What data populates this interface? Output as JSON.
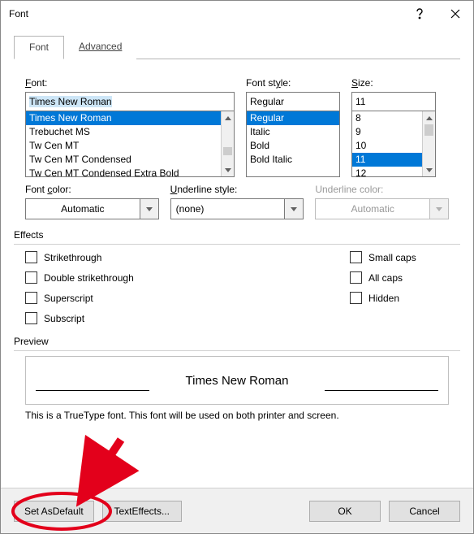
{
  "title": "Font",
  "tabs": {
    "font": "Font",
    "advanced": "Advanced"
  },
  "labels": {
    "font": "Font:",
    "font_key": "F",
    "style": "Font style:",
    "style_key": "y",
    "size": "Size:",
    "size_key": "S",
    "color": "Font color:",
    "color_key": "c",
    "uline": "Underline style:",
    "uline_key": "U",
    "ulcolor": "Underline color:",
    "ulcolor_key": "U"
  },
  "font_input": "Times New Roman",
  "font_list": [
    "Times New Roman",
    "Trebuchet MS",
    "Tw Cen MT",
    "Tw Cen MT Condensed",
    "Tw Cen MT Condensed Extra Bold"
  ],
  "font_selected_index": 0,
  "style_input": "Regular",
  "style_list": [
    "Regular",
    "Italic",
    "Bold",
    "Bold Italic"
  ],
  "style_selected_index": 0,
  "size_input": "11",
  "size_list": [
    "8",
    "9",
    "10",
    "11",
    "12"
  ],
  "size_selected_index": 3,
  "font_color": "Automatic",
  "underline_style": "(none)",
  "underline_color": "Automatic",
  "effects_title": "Effects",
  "effects": {
    "strike": "Strikethrough",
    "dstrike": "Double strikethrough",
    "super": "Superscript",
    "sub": "Subscript",
    "smallcaps": "Small caps",
    "allcaps": "All caps",
    "hidden": "Hidden"
  },
  "effects_keys": {
    "strike": "k",
    "dstrike": "l",
    "super": "p",
    "sub": "b",
    "smallcaps": "m",
    "allcaps": "A",
    "hidden": "H"
  },
  "preview_title": "Preview",
  "preview_text": "Times New Roman",
  "desc": "This is a TrueType font. This font will be used on both printer and screen.",
  "buttons": {
    "default": "Set As Default",
    "default_key": "D",
    "texteffects": "Text Effects...",
    "texteffects_key": "E",
    "ok": "OK",
    "cancel": "Cancel"
  }
}
